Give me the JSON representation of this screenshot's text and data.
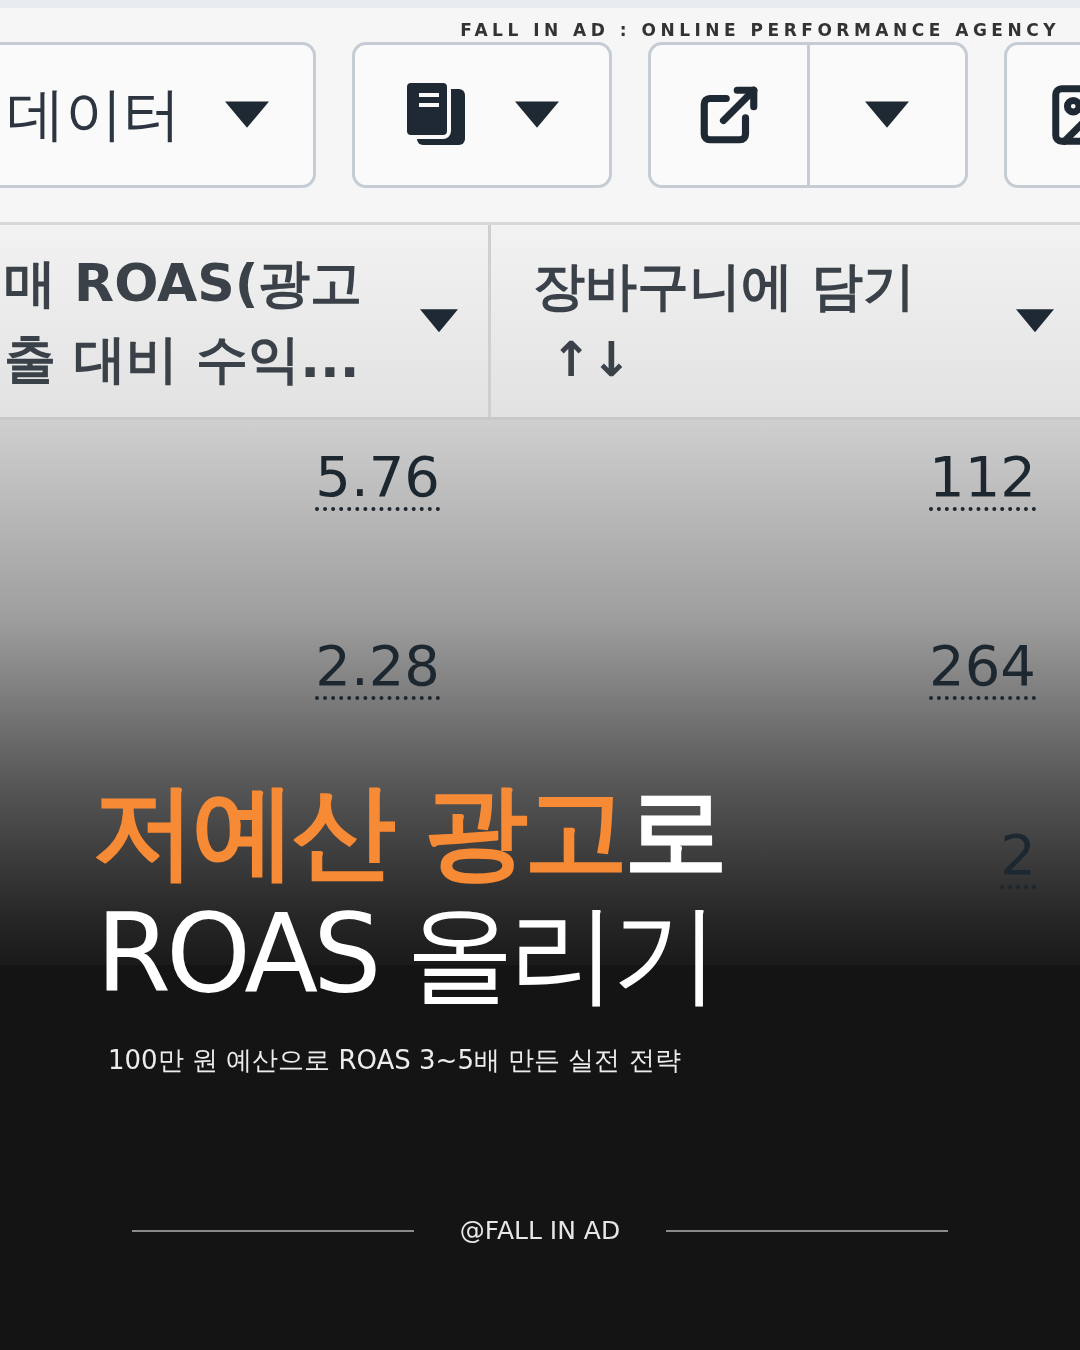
{
  "brand_tagline": "FALL IN AD : ONLINE PERFORMANCE AGENCY",
  "screenshot": {
    "toolbar": [
      {
        "kind": "dropdown",
        "label": "데이터"
      },
      {
        "kind": "icon_dropdown"
      },
      {
        "kind": "split"
      },
      {
        "kind": "icon"
      }
    ],
    "columns": [
      {
        "label_lines": [
          "매 ROAS(광고",
          "출 대비 수익..."
        ]
      },
      {
        "label_lines": [
          "장바구니에 담기"
        ],
        "sort_icon": "↑↓"
      }
    ],
    "rows": [
      {
        "column_1": "5.76",
        "column_2": "112"
      },
      {
        "column_1": "2.28",
        "column_2": "264"
      },
      {
        "column_2": "2"
      }
    ]
  },
  "title": {
    "accent": "저예산 광고",
    "line1_rest": "로",
    "line2": "ROAS 올리기"
  },
  "subtitle": "100만 원 예산으로 ROAS 3~5배 만든 실전 전략",
  "handle": "@FALL IN AD"
}
